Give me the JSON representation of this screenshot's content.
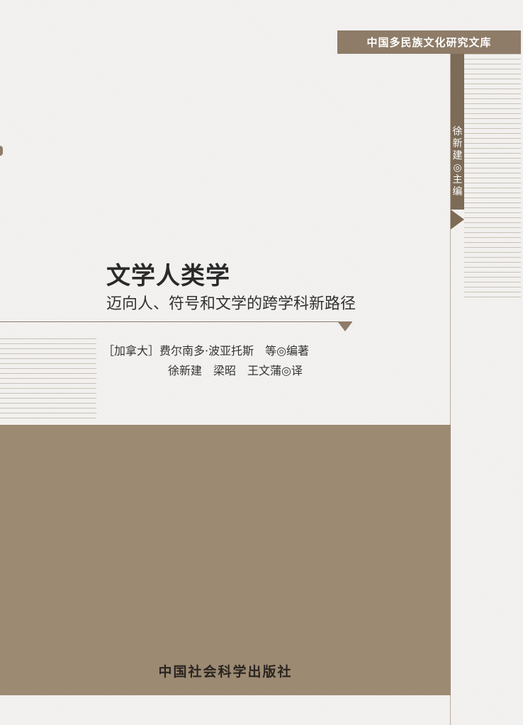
{
  "series": {
    "name": "中国多民族文化研究文库"
  },
  "editor": {
    "credit": "徐新建◎主编"
  },
  "book": {
    "title": "文学人类学",
    "subtitle": "迈向人、符号和文学的跨学科新路径"
  },
  "credits": {
    "authors": "［加拿大］费尔南多·波亚托斯　等◎编著",
    "translators": "徐新建　梁昭　王文蒲◎译"
  },
  "publisher": {
    "name": "中国社会科学出版社"
  },
  "colors": {
    "accent_brown": "#9d8a73",
    "banner_brown": "#8e7c68",
    "background": "#f3f2f0"
  }
}
